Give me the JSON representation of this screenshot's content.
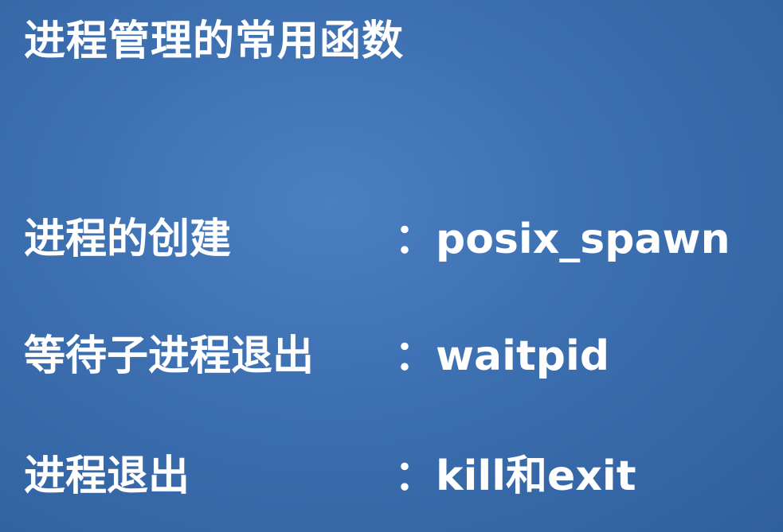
{
  "slide": {
    "title": "进程管理的常用函数",
    "items": [
      {
        "label": "进程的创建",
        "value": "：posix_spawn"
      },
      {
        "label": "等待子进程退出",
        "value": "：waitpid"
      },
      {
        "label": "进程退出",
        "value": "：kill和exit"
      }
    ]
  }
}
